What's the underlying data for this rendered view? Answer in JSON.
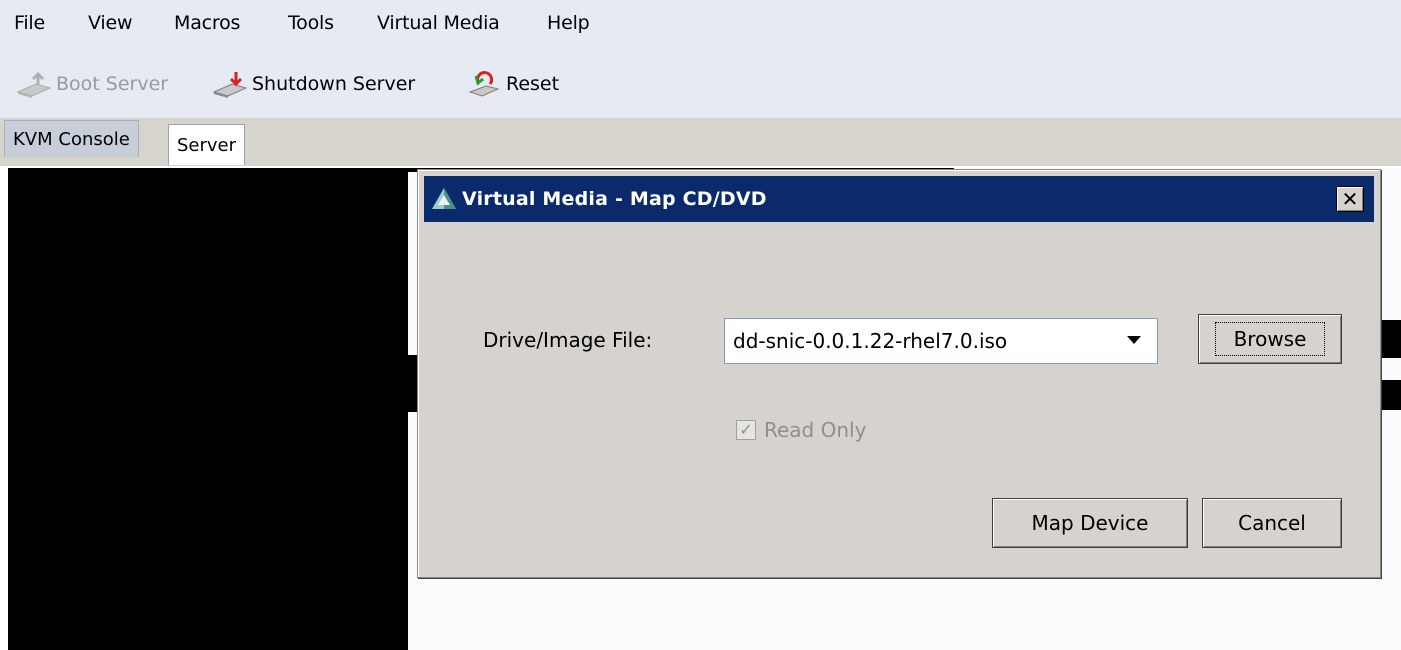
{
  "menubar": {
    "items": [
      "File",
      "View",
      "Macros",
      "Tools",
      "Virtual Media",
      "Help"
    ]
  },
  "toolbar": {
    "boot_label": "Boot Server",
    "shutdown_label": "Shutdown Server",
    "reset_label": "Reset",
    "icons": [
      "boot-server-icon",
      "shutdown-server-icon",
      "reset-icon"
    ]
  },
  "tabs": {
    "kvm": "KVM Console",
    "server": "Server"
  },
  "dialog": {
    "title": "Virtual Media - Map CD/DVD",
    "close_glyph": "✕",
    "drive_label": "Drive/Image File:",
    "drive_value": "dd-snic-0.0.1.22-rhel7.0.iso",
    "browse_label": "Browse",
    "readonly_label": "Read Only",
    "readonly_checked": true,
    "map_label": "Map Device",
    "cancel_label": "Cancel",
    "title_bar_color": "#0b2a6b"
  }
}
